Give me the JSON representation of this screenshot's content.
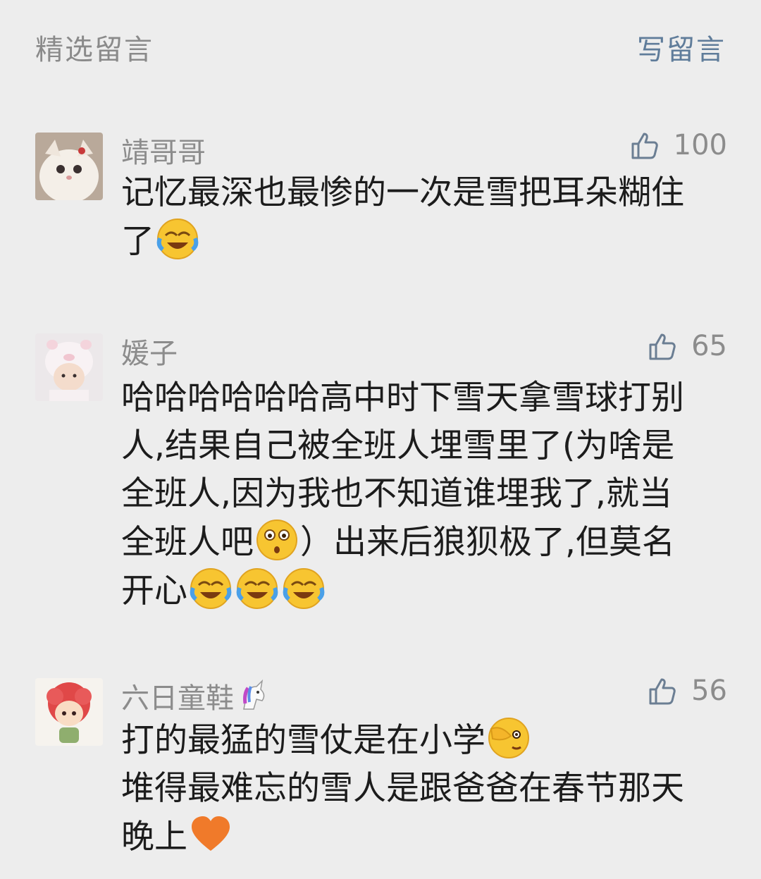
{
  "header": {
    "title": "精选留言",
    "write_label": "写留言"
  },
  "comments": [
    {
      "nickname": "靖哥哥",
      "likes": "100",
      "avatar": "white-cat-avatar",
      "text1": "记忆最深也最惨的一次是雪把耳朵糊住\n了",
      "emojis": [
        "laughing-crying-emoji"
      ]
    },
    {
      "nickname": "媛子",
      "likes": "65",
      "avatar": "baby-pig-hat-avatar",
      "text1": "哈哈哈哈哈哈高中时下雪天拿雪球打别\n人,结果自己被全班人埋雪里了(为啥是\n全班人,因为我也不知道谁埋我了,就当\n全班人吧",
      "text2": "）出来后狼狈极了,但莫名\n开心",
      "emojis": [
        "surprised-emoji",
        "laughing-crying-emoji",
        "laughing-crying-emoji",
        "laughing-crying-emoji"
      ]
    },
    {
      "nickname": "六日童鞋",
      "likes": "56",
      "avatar": "red-hair-cartoon-avatar",
      "nick_icon": "unicorn-icon",
      "text1": "打的最猛的雪仗是在小学",
      "text2": "\n堆得最难忘的雪人是跟爸爸在春节那天\n晚上",
      "emojis": [
        "facepalm-emoji",
        "orange-heart-icon"
      ]
    }
  ]
}
